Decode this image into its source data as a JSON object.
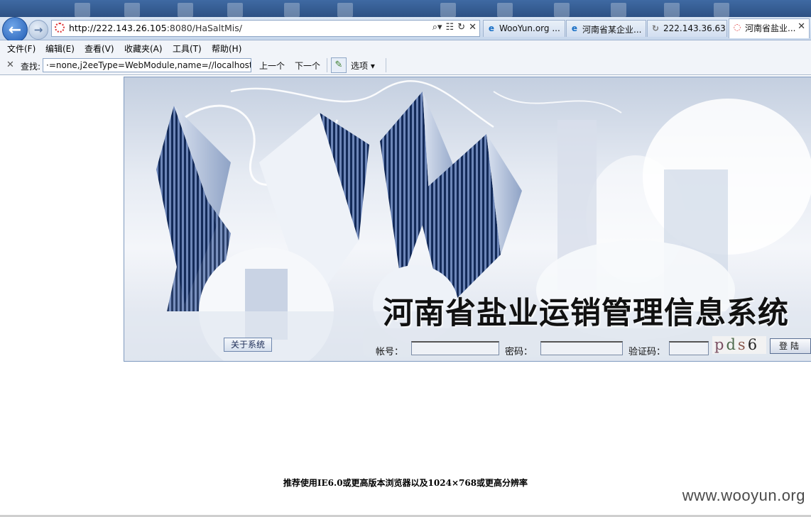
{
  "browser": {
    "url_prefix": "http://222.143.26.105",
    "url_suffix": ":8080/HaSaltMis/",
    "tabs": [
      {
        "label": "WooYun.org ..."
      },
      {
        "label": "河南省某企业..."
      },
      {
        "label": "222.143.36.63"
      },
      {
        "label": "河南省盐业..."
      }
    ],
    "menu": [
      "文件(F)",
      "编辑(E)",
      "查看(V)",
      "收藏夹(A)",
      "工具(T)",
      "帮助(H)"
    ],
    "findbar": {
      "label": "查找:",
      "value": "·=none,j2eeType=WebModule,name=//localhost/",
      "prev": "上一个",
      "next": "下一个",
      "options": "选项"
    }
  },
  "page": {
    "system_title": "河南省盐业运销管理信息系统",
    "about_button": "关于系统",
    "account_label": "帐号：",
    "password_label": "密码：",
    "captcha_label": "验证码：",
    "captcha_chars": [
      "p",
      "d",
      "s",
      "6"
    ],
    "login_button": "登陆",
    "recommendation": "推荐使用IE6.0或更高版本浏览器以及1024×768或更高分辨率"
  },
  "watermark": "www.wooyun.org"
}
